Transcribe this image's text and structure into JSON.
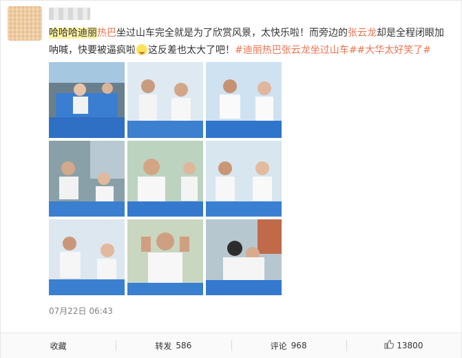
{
  "post": {
    "text_segments": [
      {
        "text": "哈哈哈迪丽",
        "style": "hl"
      },
      {
        "text": "热巴",
        "style": "red"
      },
      {
        "text": "坐过山车完全就是为了欣赏风景，太快乐啦！而旁边的",
        "style": "normal"
      },
      {
        "text": "张云龙",
        "style": "red"
      },
      {
        "text": "却是全程闭眼加呐喊，快要被逼疯啦",
        "style": "normal"
      },
      {
        "text": "EMOJI",
        "style": "emoji"
      },
      {
        "text": "这反差也太大了吧！",
        "style": "normal"
      },
      {
        "text": "#迪丽",
        "style": "link"
      },
      {
        "text": "热巴张云龙",
        "style": "red"
      },
      {
        "text": "坐过山车##大华太好笑了#",
        "style": "link"
      }
    ],
    "timestamp": "07月22日 06:43"
  },
  "colors": {
    "accent": "#eb7350",
    "text": "#333333",
    "muted": "#808080"
  },
  "actions": {
    "favorite": {
      "label": "收藏",
      "count": ""
    },
    "repost": {
      "label": "转发",
      "count": "586"
    },
    "comment": {
      "label": "评论",
      "count": "968"
    },
    "like": {
      "label": "",
      "count": "13800",
      "icon": "thumbs-up-icon"
    }
  },
  "images": [
    {
      "alt": "photo-1"
    },
    {
      "alt": "photo-2"
    },
    {
      "alt": "photo-3"
    },
    {
      "alt": "photo-4"
    },
    {
      "alt": "photo-5"
    },
    {
      "alt": "photo-6"
    },
    {
      "alt": "photo-7"
    },
    {
      "alt": "photo-8"
    },
    {
      "alt": "photo-9"
    }
  ]
}
